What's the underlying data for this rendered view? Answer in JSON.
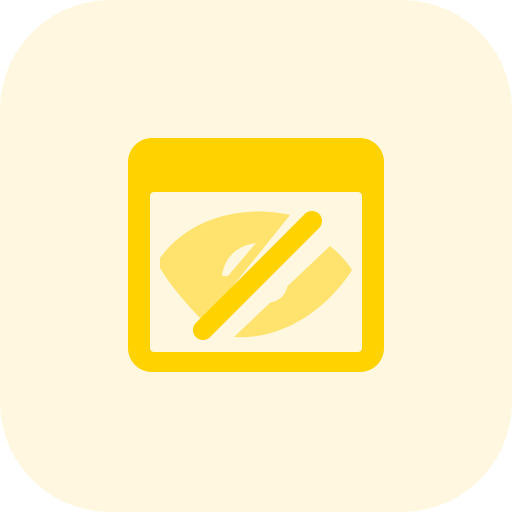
{
  "icon": {
    "name": "browser-window-eye-slash-icon",
    "colors": {
      "background": "#FFF7DF",
      "frame": "#FFD200",
      "eye": "#FFE36E",
      "window_inner": "#FFF7DF"
    }
  }
}
